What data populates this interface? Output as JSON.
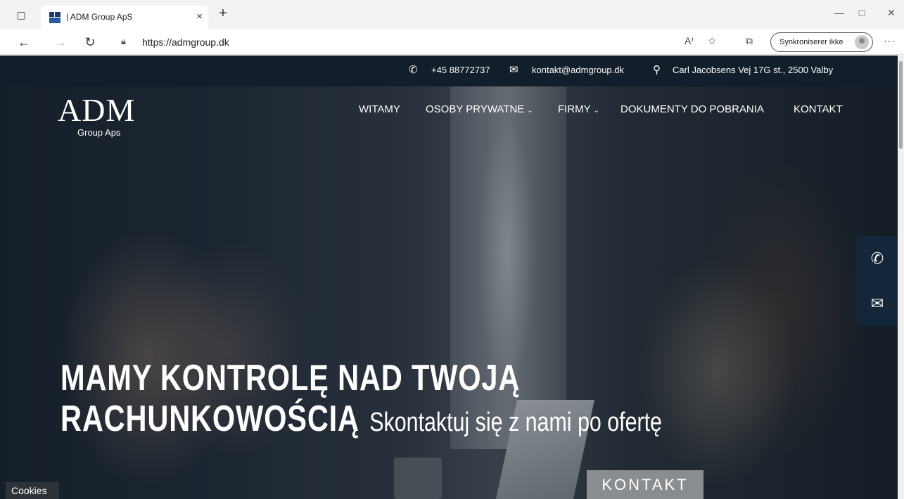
{
  "browser": {
    "tab_title": "| ADM Group ApS",
    "tab_close": "×",
    "new_tab": "+",
    "url": "https://admgroup.dk",
    "sync_label": "Synkroniserer ikke",
    "more": "···"
  },
  "topbar": {
    "phone": "+45 88772737",
    "email": "kontakt@admgroup.dk",
    "address": "Carl Jacobsens Vej 17G st., 2500 Valby"
  },
  "logo": {
    "main": "ADM",
    "sub": "Group Aps"
  },
  "nav": {
    "items": [
      {
        "label": "WITAMY"
      },
      {
        "label": "OSOBY PRYWATNE",
        "dropdown": true
      },
      {
        "label": "FIRMY",
        "dropdown": true
      },
      {
        "label": "DOKUMENTY DO POBRANIA"
      },
      {
        "label": "KONTAKT"
      }
    ]
  },
  "hero": {
    "line1": "MAMY KONTROLĘ NAD TWOJĄ",
    "line2": "RACHUNKOWOŚCIĄ",
    "subline": "Skontaktuj się z nami po ofertę",
    "cta": "KONTAKT"
  },
  "cookies": "Cookies",
  "icons": {
    "phone": "phone-icon",
    "email": "envelope-icon",
    "location": "map-pin-icon"
  },
  "colors": {
    "topbar_bg": "#121e2a",
    "side_button_bg": "#14263a",
    "cta_bg": "#8a8d90"
  }
}
